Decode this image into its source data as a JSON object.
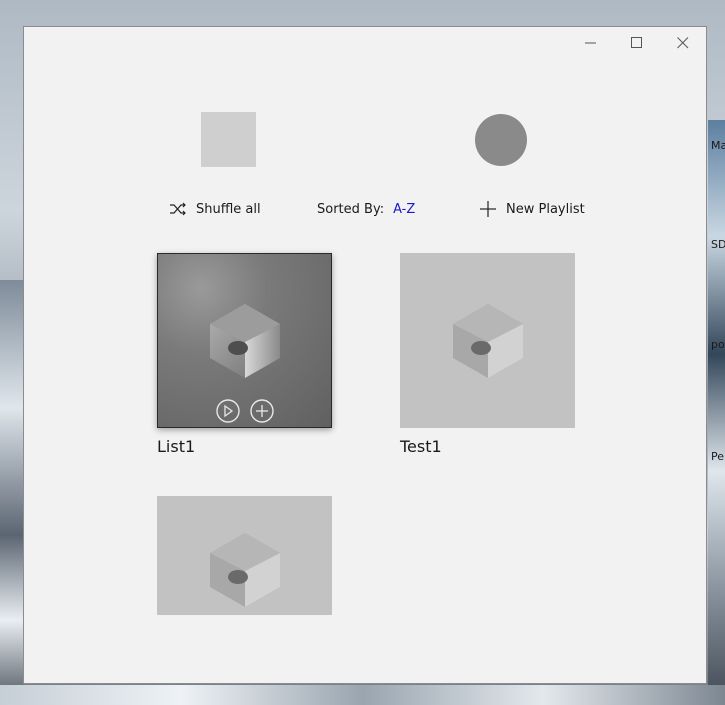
{
  "window": {
    "caption": {
      "minimize": "minimize-icon",
      "maximize": "maximize-icon",
      "close": "close-icon"
    }
  },
  "toolbar": {
    "shuffle_label": "Shuffle all",
    "sorted_label": "Sorted By:",
    "sorted_value": "A-Z",
    "new_playlist_label": "New Playlist"
  },
  "playlists": [
    {
      "name": "List1"
    },
    {
      "name": "Test1"
    },
    {
      "name": ""
    }
  ],
  "desktop_labels": [
    "Ma",
    "SD",
    "po",
    "Pe"
  ],
  "colors": {
    "accent": "#1a18c9",
    "window_bg": "#f2f2f2"
  }
}
